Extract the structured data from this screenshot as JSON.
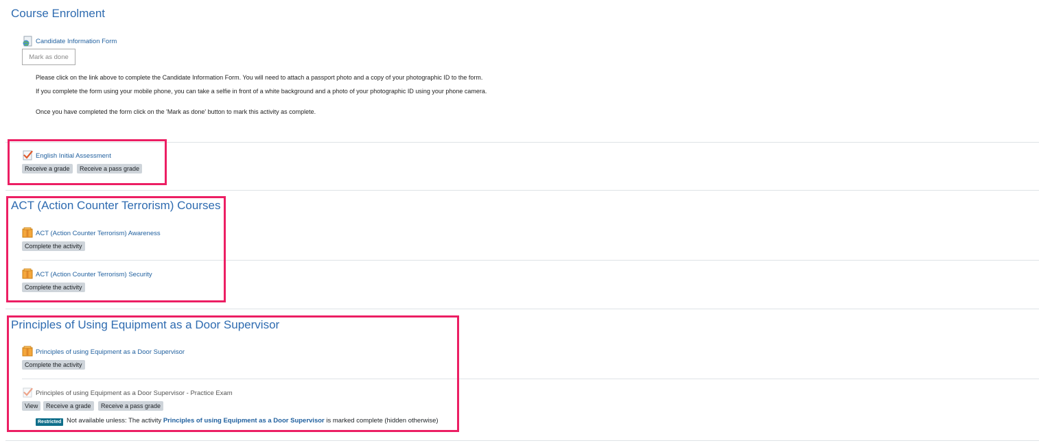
{
  "sections": {
    "course_enrolment": {
      "title": "Course Enrolment",
      "activity": "Candidate Information Form",
      "mark_done": "Mark as done",
      "para1": "Please click on the link above to complete the Candidate Information Form. You will need to attach a passport photo and a copy of your photographic ID to the form.",
      "para2": "If you complete the form using your mobile phone, you can take a selfie in front of a white background and a photo of your photographic ID using your phone camera.",
      "para3": "Once you have completed the form click on the 'Mark as done' button to mark this activity as complete."
    },
    "english": {
      "activity": "English Initial Assessment",
      "req1": "Receive a grade",
      "req2": "Receive a pass grade"
    },
    "act": {
      "title": "ACT (Action Counter Terrorism) Courses",
      "activity1": "ACT (Action Counter Terrorism) Awareness",
      "activity1_req": "Complete the activity",
      "activity2": "ACT (Action Counter Terrorism) Security",
      "activity2_req": "Complete the activity"
    },
    "principles": {
      "title": "Principles of Using Equipment as a Door Supervisor",
      "activity1": "Principles of using Equipment as a Door Supervisor",
      "activity1_req": "Complete the activity",
      "activity2": "Principles of using Equipment as a Door Supervisor - Practice Exam",
      "req_view": "View",
      "req_grade": "Receive a grade",
      "req_pass": "Receive a pass grade",
      "restricted_badge": "Restricted",
      "avail_prefix": "Not available unless: The activity",
      "avail_link": "Principles of using Equipment as a Door Supervisor",
      "avail_suffix": "is marked complete (hidden otherwise)"
    }
  },
  "icons": {
    "url": "globe-doc-icon",
    "quiz": "checkmark-quiz-icon",
    "scorm": "package-box-icon"
  },
  "colors": {
    "link": "#1f5f9e",
    "title": "#2e6bb0",
    "highlight": "#ec1e63",
    "badge": "#ced4da",
    "restricted": "#0f6e8a"
  }
}
